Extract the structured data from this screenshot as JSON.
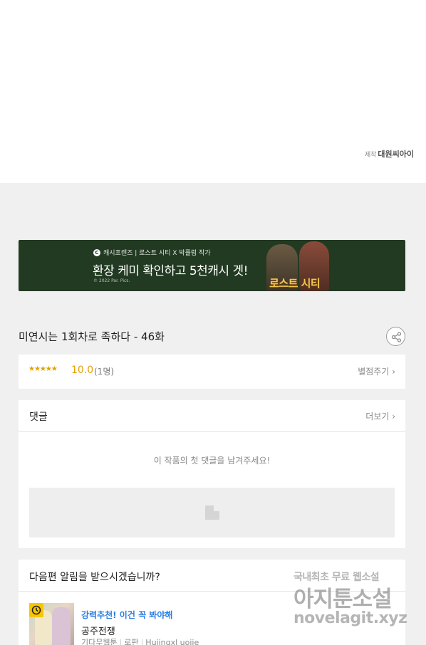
{
  "credit": {
    "prefix": "제작",
    "studio": "대원씨아이"
  },
  "banner": {
    "brand": "캐시프렌즈 | 로스트 시티 X 박플럼 작가",
    "headline": "환장 케미 확인하고 5천캐시 겟!",
    "copyright": "© 2022 Par. Pics.",
    "logo_text": "로스트 시티"
  },
  "episode": {
    "title": "미연시는 1회차로 족하다 - 46화"
  },
  "rating": {
    "stars": "★★★★★",
    "score": "10.0",
    "count": "(1명)",
    "rate_link": "별점주기 ›"
  },
  "comments": {
    "title": "댓글",
    "more_link": "더보기 ›",
    "empty_message": "이 작품의 첫 댓글을 남겨주세요!"
  },
  "notify": {
    "title": "다음편 알림을 받으시겠습니까?",
    "promo": "강력추천! 이건 꼭 봐야해",
    "work_title": "공주전쟁",
    "meta": [
      "기다무웹툰",
      "로판",
      "Huiingxl uojie"
    ]
  },
  "watermark": {
    "line1": "국내최초 무료 웹소설",
    "line2": "아지툰소설",
    "line3": "novelagit.xyz"
  }
}
